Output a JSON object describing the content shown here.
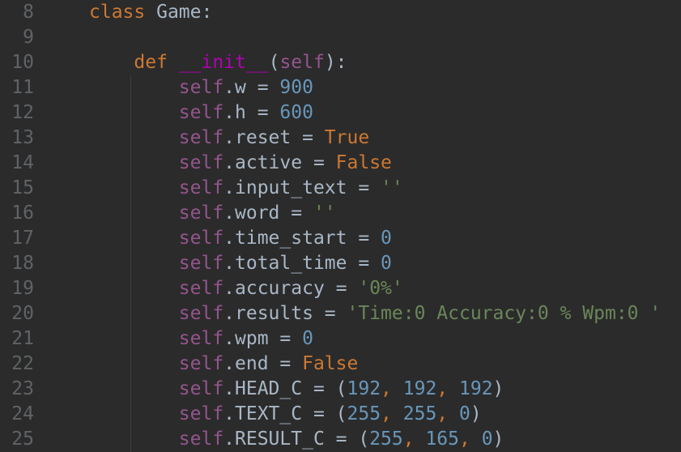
{
  "editor": {
    "background": "#2b2b2b",
    "colors": {
      "keyword": "#cc7832",
      "text": "#a9b7c6",
      "magic": "#b200b2",
      "self": "#94558d",
      "number": "#6897bb",
      "string": "#6a8759",
      "line_number": "#606366"
    },
    "lines": [
      {
        "num": "8",
        "tokens": [
          {
            "t": "class",
            "c": "kw"
          },
          {
            "t": " Game:",
            "c": "plain"
          }
        ]
      },
      {
        "num": "9",
        "tokens": []
      },
      {
        "num": "10",
        "tokens": [
          {
            "t": "    ",
            "c": "plain"
          },
          {
            "t": "def",
            "c": "kw"
          },
          {
            "t": " ",
            "c": "plain"
          },
          {
            "t": "__init__",
            "c": "magic"
          },
          {
            "t": "(",
            "c": "plain"
          },
          {
            "t": "self",
            "c": "self"
          },
          {
            "t": "):",
            "c": "plain"
          }
        ]
      },
      {
        "num": "11",
        "tokens": [
          {
            "t": "        ",
            "c": "plain"
          },
          {
            "t": "self",
            "c": "self"
          },
          {
            "t": ".w = ",
            "c": "plain"
          },
          {
            "t": "900",
            "c": "num"
          }
        ]
      },
      {
        "num": "12",
        "tokens": [
          {
            "t": "        ",
            "c": "plain"
          },
          {
            "t": "self",
            "c": "self"
          },
          {
            "t": ".h = ",
            "c": "plain"
          },
          {
            "t": "600",
            "c": "num"
          }
        ]
      },
      {
        "num": "13",
        "tokens": [
          {
            "t": "        ",
            "c": "plain"
          },
          {
            "t": "self",
            "c": "self"
          },
          {
            "t": ".reset = ",
            "c": "plain"
          },
          {
            "t": "True",
            "c": "kw"
          }
        ]
      },
      {
        "num": "14",
        "tokens": [
          {
            "t": "        ",
            "c": "plain"
          },
          {
            "t": "self",
            "c": "self"
          },
          {
            "t": ".active = ",
            "c": "plain"
          },
          {
            "t": "False",
            "c": "kw"
          }
        ]
      },
      {
        "num": "15",
        "tokens": [
          {
            "t": "        ",
            "c": "plain"
          },
          {
            "t": "self",
            "c": "self"
          },
          {
            "t": ".input_text = ",
            "c": "plain"
          },
          {
            "t": "''",
            "c": "str"
          }
        ]
      },
      {
        "num": "16",
        "tokens": [
          {
            "t": "        ",
            "c": "plain"
          },
          {
            "t": "self",
            "c": "self"
          },
          {
            "t": ".word = ",
            "c": "plain"
          },
          {
            "t": "''",
            "c": "str"
          }
        ]
      },
      {
        "num": "17",
        "tokens": [
          {
            "t": "        ",
            "c": "plain"
          },
          {
            "t": "self",
            "c": "self"
          },
          {
            "t": ".time_start = ",
            "c": "plain"
          },
          {
            "t": "0",
            "c": "num"
          }
        ]
      },
      {
        "num": "18",
        "tokens": [
          {
            "t": "        ",
            "c": "plain"
          },
          {
            "t": "self",
            "c": "self"
          },
          {
            "t": ".total_time = ",
            "c": "plain"
          },
          {
            "t": "0",
            "c": "num"
          }
        ]
      },
      {
        "num": "19",
        "tokens": [
          {
            "t": "        ",
            "c": "plain"
          },
          {
            "t": "self",
            "c": "self"
          },
          {
            "t": ".accuracy = ",
            "c": "plain"
          },
          {
            "t": "'0%'",
            "c": "str"
          }
        ]
      },
      {
        "num": "20",
        "tokens": [
          {
            "t": "        ",
            "c": "plain"
          },
          {
            "t": "self",
            "c": "self"
          },
          {
            "t": ".results = ",
            "c": "plain"
          },
          {
            "t": "'Time:0 Accuracy:0 % Wpm:0 '",
            "c": "str"
          }
        ]
      },
      {
        "num": "21",
        "tokens": [
          {
            "t": "        ",
            "c": "plain"
          },
          {
            "t": "self",
            "c": "self"
          },
          {
            "t": ".wpm = ",
            "c": "plain"
          },
          {
            "t": "0",
            "c": "num"
          }
        ]
      },
      {
        "num": "22",
        "tokens": [
          {
            "t": "        ",
            "c": "plain"
          },
          {
            "t": "self",
            "c": "self"
          },
          {
            "t": ".end = ",
            "c": "plain"
          },
          {
            "t": "False",
            "c": "kw"
          }
        ]
      },
      {
        "num": "23",
        "tokens": [
          {
            "t": "        ",
            "c": "plain"
          },
          {
            "t": "self",
            "c": "self"
          },
          {
            "t": ".HEAD_C = (",
            "c": "plain"
          },
          {
            "t": "192",
            "c": "num"
          },
          {
            "t": ", ",
            "c": "comma"
          },
          {
            "t": "192",
            "c": "num"
          },
          {
            "t": ", ",
            "c": "comma"
          },
          {
            "t": "192",
            "c": "num"
          },
          {
            "t": ")",
            "c": "plain"
          }
        ]
      },
      {
        "num": "24",
        "tokens": [
          {
            "t": "        ",
            "c": "plain"
          },
          {
            "t": "self",
            "c": "self"
          },
          {
            "t": ".TEXT_C = (",
            "c": "plain"
          },
          {
            "t": "255",
            "c": "num"
          },
          {
            "t": ", ",
            "c": "comma"
          },
          {
            "t": "255",
            "c": "num"
          },
          {
            "t": ", ",
            "c": "comma"
          },
          {
            "t": "0",
            "c": "num"
          },
          {
            "t": ")",
            "c": "plain"
          }
        ]
      },
      {
        "num": "25",
        "tokens": [
          {
            "t": "        ",
            "c": "plain"
          },
          {
            "t": "self",
            "c": "self"
          },
          {
            "t": ".RESULT_C = (",
            "c": "plain"
          },
          {
            "t": "255",
            "c": "num"
          },
          {
            "t": ", ",
            "c": "comma"
          },
          {
            "t": "165",
            "c": "num"
          },
          {
            "t": ", ",
            "c": "comma"
          },
          {
            "t": "0",
            "c": "num"
          },
          {
            "t": ")",
            "c": "plain"
          }
        ]
      }
    ]
  }
}
